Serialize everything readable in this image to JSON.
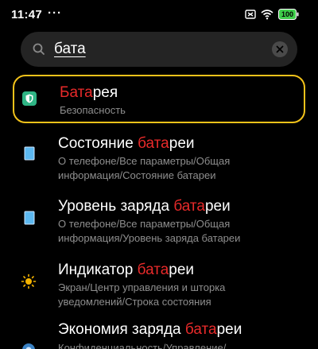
{
  "status": {
    "time": "11:47",
    "dots": "···",
    "battery_level": "100",
    "colors": {
      "battery": "#3fce4a"
    }
  },
  "search": {
    "query": "бата",
    "placeholder": ""
  },
  "results": [
    {
      "title_pre": "",
      "title_hl": "Бата",
      "title_post": "рея",
      "path_line1": "Безопасность",
      "path_line2": "",
      "icon": "shield-icon"
    },
    {
      "title_pre": "Состояние ",
      "title_hl": "бата",
      "title_post": "реи",
      "path_line1": "О телефоне/Все параметры/Общая",
      "path_line2": "информация/Состояние батареи",
      "icon": "phone-icon"
    },
    {
      "title_pre": "Уровень заряда ",
      "title_hl": "бата",
      "title_post": "реи",
      "path_line1": "О телефоне/Все параметры/Общая",
      "path_line2": "информация/Уровень заряда батареи",
      "icon": "phone-icon"
    },
    {
      "title_pre": "Индикатор ",
      "title_hl": "бата",
      "title_post": "реи",
      "path_line1": "Экран/Центр управления и шторка",
      "path_line2": "уведомлений/Строка состояния",
      "icon": "sun-icon"
    },
    {
      "title_pre": "Экономия заряда ",
      "title_hl": "бата",
      "title_post": "реи",
      "path_line1": "Конфиденциальность/Управление/",
      "path_line2": "",
      "icon": "settings-icon"
    }
  ],
  "colors": {
    "highlight_text": "#e82a2a",
    "selection_border": "#f2c21a"
  }
}
